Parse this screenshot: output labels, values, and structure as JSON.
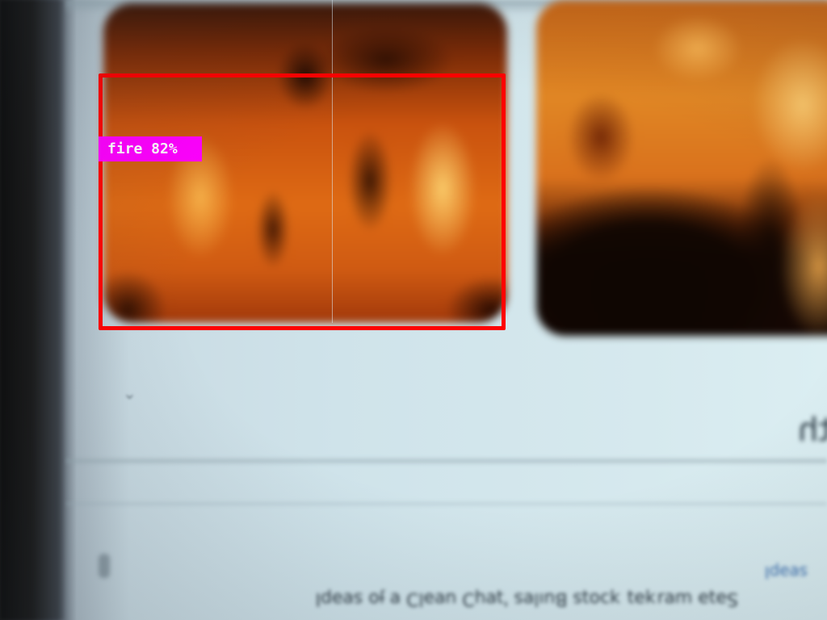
{
  "photo": {
    "description_hidden": false,
    "mirrored_heading": "ith",
    "mirrored_body_text": "Ѕǝʇǝ ɯɐɹʞǝʇ ʞɔoʇs Buılɐs 'ʇɐɥƆ uɐǝlƆ ɐ ɟo sɐǝpI",
    "mirrored_link_text": "sɐǝpI"
  },
  "detections": [
    {
      "label": "fire 82%",
      "class": "fire",
      "confidence_percent": 82
    }
  ],
  "colors": {
    "detection_box": "#ff0000",
    "label_background": "#ff00ff",
    "label_text": "#ffffff"
  }
}
